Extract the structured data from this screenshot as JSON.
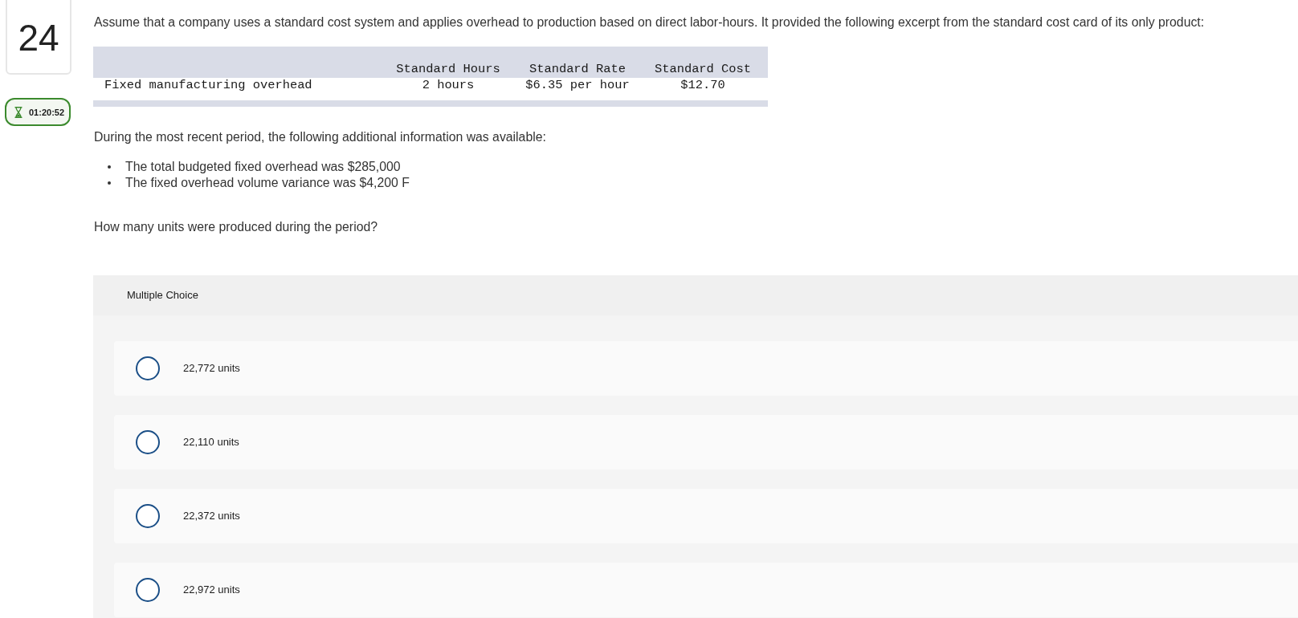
{
  "question": {
    "number": "24",
    "timer": "01:20:52"
  },
  "prompt": "Assume that a company uses a standard cost system and applies overhead to production based on direct labor-hours. It provided the following excerpt from the standard cost card of its only product:",
  "cost_card": {
    "columns": [
      "Standard Hours",
      "Standard Rate",
      "Standard Cost"
    ],
    "rows": [
      {
        "label": "Fixed manufacturing overhead",
        "cells": [
          "2 hours",
          "$6.35 per hour",
          "$12.70"
        ]
      }
    ]
  },
  "info_intro": "During the most recent period, the following additional information was available:",
  "info_items": [
    "The total budgeted fixed overhead was $285,000",
    "The fixed overhead volume variance was $4,200 F"
  ],
  "question_text": "How many units were produced during the period?",
  "answer_panel": {
    "title": "Multiple Choice",
    "options": [
      {
        "label": "22,772 units",
        "selected": false
      },
      {
        "label": "22,110 units",
        "selected": false
      },
      {
        "label": "22,372 units",
        "selected": false
      },
      {
        "label": "22,972 units",
        "selected": false
      }
    ]
  }
}
